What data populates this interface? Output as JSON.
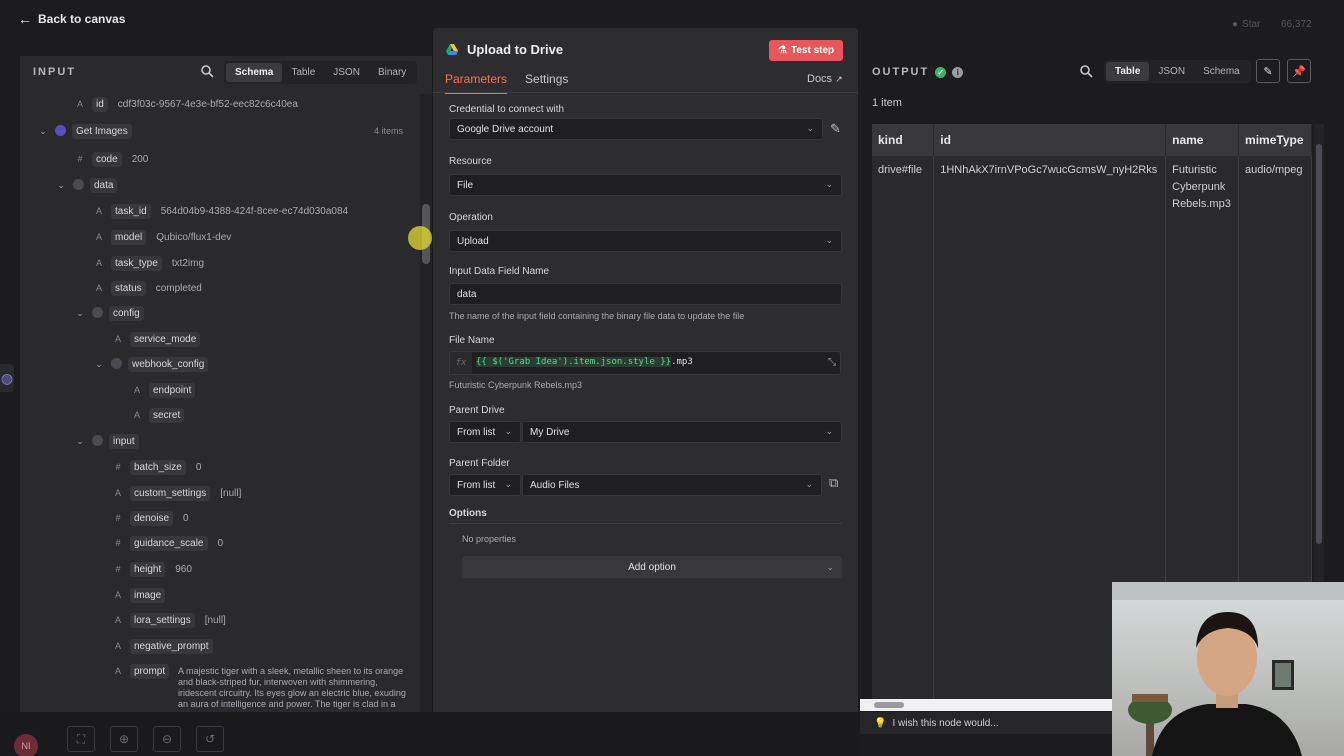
{
  "topbar": {
    "back_label": "Back to canvas",
    "github_label": "Star",
    "github_count": "66,372"
  },
  "input_panel": {
    "title": "INPUT",
    "view_tabs": [
      "Schema",
      "Table",
      "JSON",
      "Binary"
    ],
    "active_tab": "Schema",
    "get_images_count": "4 items",
    "tree": [
      {
        "type": "A",
        "key": "id",
        "value": "cdf3f03c-9567-4e3e-bf52-eec82c6c40ea"
      },
      {
        "type": "obj",
        "key": "Get Images"
      },
      {
        "type": "#",
        "key": "code",
        "value": "200"
      },
      {
        "type": "obj",
        "key": "data"
      },
      {
        "type": "A",
        "key": "task_id",
        "value": "564d04b9-4388-424f-8cee-ec74d030a084"
      },
      {
        "type": "A",
        "key": "model",
        "value": "Qubico/flux1-dev"
      },
      {
        "type": "A",
        "key": "task_type",
        "value": "txt2img"
      },
      {
        "type": "A",
        "key": "status",
        "value": "completed"
      },
      {
        "type": "obj",
        "key": "config"
      },
      {
        "type": "A",
        "key": "service_mode",
        "value": ""
      },
      {
        "type": "obj",
        "key": "webhook_config"
      },
      {
        "type": "A",
        "key": "endpoint",
        "value": ""
      },
      {
        "type": "A",
        "key": "secret",
        "value": ""
      },
      {
        "type": "obj",
        "key": "input"
      },
      {
        "type": "#",
        "key": "batch_size",
        "value": "0"
      },
      {
        "type": "A",
        "key": "custom_settings",
        "value": "[null]"
      },
      {
        "type": "#",
        "key": "denoise",
        "value": "0"
      },
      {
        "type": "#",
        "key": "guidance_scale",
        "value": "0"
      },
      {
        "type": "#",
        "key": "height",
        "value": "960"
      },
      {
        "type": "A",
        "key": "image",
        "value": ""
      },
      {
        "type": "A",
        "key": "lora_settings",
        "value": "[null]"
      },
      {
        "type": "A",
        "key": "negative_prompt",
        "value": ""
      },
      {
        "type": "A",
        "key": "prompt",
        "value": "A majestic tiger with a sleek, metallic sheen to its orange and black-striped fur, interwoven with shimmering, iridescent circuitry. Its eyes glow an electric blue, exuding an aura of intelligence and power. The tiger is clad in a high-tech, armored"
      }
    ]
  },
  "node": {
    "title": "Upload to Drive",
    "test_button": "Test step",
    "tabs": [
      "Parameters",
      "Settings"
    ],
    "active_tab": "Parameters",
    "docs_label": "Docs",
    "credential_label": "Credential to connect with",
    "credential_value": "Google Drive account",
    "resource_label": "Resource",
    "resource_value": "File",
    "operation_label": "Operation",
    "operation_value": "Upload",
    "input_field_label": "Input Data Field Name",
    "input_field_value": "data",
    "input_field_hint": "The name of the input field containing the binary file data to update the file",
    "file_name_label": "File Name",
    "file_name_fx": "fx",
    "file_name_expr": "{{ $('Grab Idea').item.json.style }}",
    "file_name_suffix": ".mp3",
    "file_name_preview": "Futuristic Cyberpunk Rebels.mp3",
    "parent_drive_label": "Parent Drive",
    "parent_drive_mode": "From list",
    "parent_drive_value": "My Drive",
    "parent_folder_label": "Parent Folder",
    "parent_folder_mode": "From list",
    "parent_folder_value": "Audio Files",
    "options_label": "Options",
    "no_properties": "No properties",
    "add_option": "Add option"
  },
  "output": {
    "title": "OUTPUT",
    "items": "1 item",
    "view_tabs": [
      "Table",
      "JSON",
      "Schema"
    ],
    "active_tab": "Table",
    "columns": [
      "kind",
      "id",
      "name",
      "mimeType"
    ],
    "rows": [
      {
        "kind": "drive#file",
        "id": "1HNhAkX7irnVPoGc7wucGcmsW_nyH2Rks",
        "name": "Futuristic Cyberpunk Rebels.mp3",
        "mimeType": "audio/mpeg"
      }
    ],
    "wish_text": "I wish this node would..."
  },
  "bottom": {
    "avatar": "NI"
  },
  "colors": {
    "accent": "#ff6d5a",
    "test_button": "#e8555a",
    "success": "#3bb36a",
    "expression": "#5fd088"
  }
}
